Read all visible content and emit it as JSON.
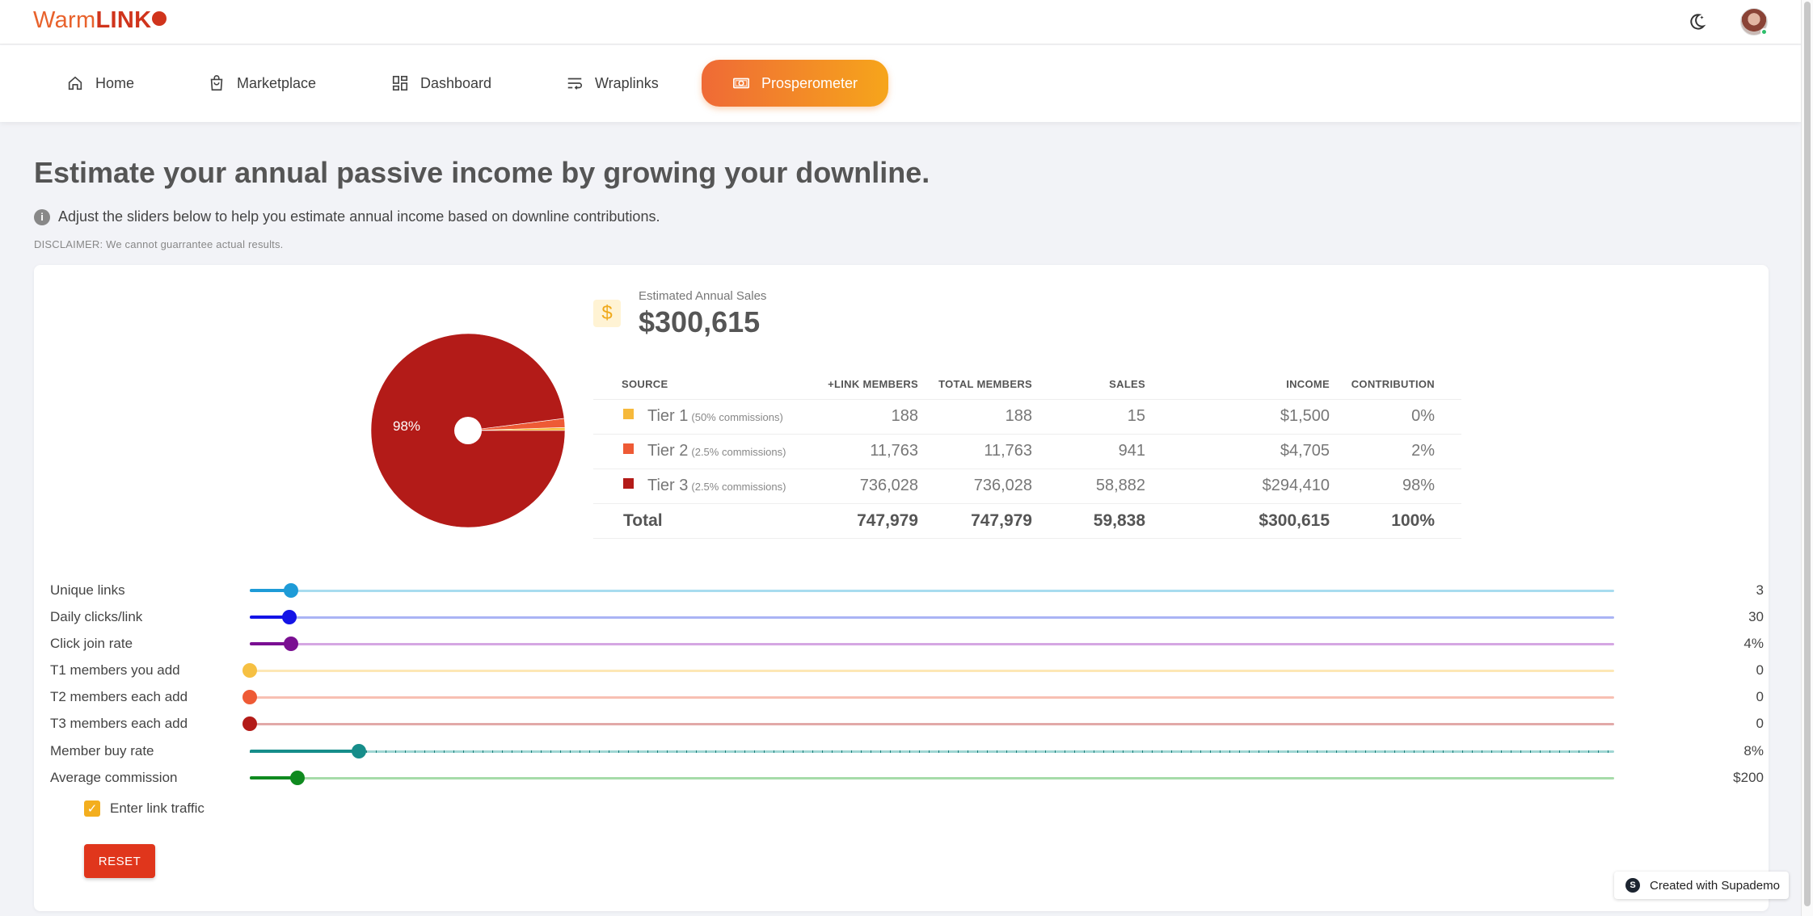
{
  "brand": {
    "warm": "Warm",
    "link": "LINK"
  },
  "nav": {
    "home": "Home",
    "marketplace": "Marketplace",
    "dashboard": "Dashboard",
    "wraplinks": "Wraplinks",
    "prosperometer": "Prosperometer"
  },
  "page": {
    "title": "Estimate your annual passive income by growing your downline.",
    "info": "Adjust the sliders below to help you estimate annual income based on downline contributions.",
    "disclaimer": "DISCLAIMER: We cannot guarrantee actual results."
  },
  "estimate": {
    "label": "Estimated Annual Sales",
    "value": "$300,615",
    "dollar": "$"
  },
  "pie": {
    "label": "98%",
    "slices": [
      {
        "name": "Tier 1",
        "pct": 0.5,
        "color": "#f6b93b"
      },
      {
        "name": "Tier 2",
        "pct": 1.5,
        "color": "#ee5a35"
      },
      {
        "name": "Tier 3",
        "pct": 98,
        "color": "#b31b18"
      }
    ]
  },
  "table": {
    "headers": {
      "source": "SOURCE",
      "link_members": "+LINK MEMBERS",
      "total_members": "TOTAL MEMBERS",
      "sales": "SALES",
      "income": "INCOME",
      "contribution": "CONTRIBUTION"
    },
    "rows": [
      {
        "tier": "Tier 1",
        "note": "(50% commissions)",
        "link_members": "188",
        "total_members": "188",
        "sales": "15",
        "income": "$1,500",
        "contribution": "0%",
        "color": "#f6b93b"
      },
      {
        "tier": "Tier 2",
        "note": "(2.5% commissions)",
        "link_members": "11,763",
        "total_members": "11,763",
        "sales": "941",
        "income": "$4,705",
        "contribution": "2%",
        "color": "#ee5a35"
      },
      {
        "tier": "Tier 3",
        "note": "(2.5% commissions)",
        "link_members": "736,028",
        "total_members": "736,028",
        "sales": "58,882",
        "income": "$294,410",
        "contribution": "98%",
        "color": "#b31b18"
      }
    ],
    "total": {
      "label": "Total",
      "link_members": "747,979",
      "total_members": "747,979",
      "sales": "59,838",
      "income": "$300,615",
      "contribution": "100%"
    }
  },
  "sliders": [
    {
      "label": "Unique links",
      "value": "3",
      "fraction": 0.03,
      "color": "#1e9bd7",
      "track": "#a8dcef"
    },
    {
      "label": "Daily clicks/link",
      "value": "30",
      "fraction": 0.029,
      "color": "#1414e6",
      "track": "#aab4f5"
    },
    {
      "label": "Click join rate",
      "value": "4%",
      "fraction": 0.03,
      "color": "#7a0f92",
      "track": "#d5a6e3"
    },
    {
      "label": "T1 members you add",
      "value": "0",
      "fraction": 0,
      "color": "#f6c042",
      "track": "#fde7b5"
    },
    {
      "label": "T2 members each add",
      "value": "0",
      "fraction": 0,
      "color": "#ee5a35",
      "track": "#f8c0b3"
    },
    {
      "label": "T3 members each add",
      "value": "0",
      "fraction": 0,
      "color": "#b31b18",
      "track": "#e2a9a8"
    },
    {
      "label": "Member buy rate",
      "value": "8%",
      "fraction": 0.08,
      "color": "#168d8a",
      "track": "#9fd6d3"
    },
    {
      "label": "Average commission",
      "value": "$200",
      "fraction": 0.035,
      "color": "#0f8a1f",
      "track": "#a6dba9"
    }
  ],
  "checkbox": {
    "label": "Enter link traffic",
    "checked": true
  },
  "reset": "RESET",
  "supademo": "Created with Supademo"
}
